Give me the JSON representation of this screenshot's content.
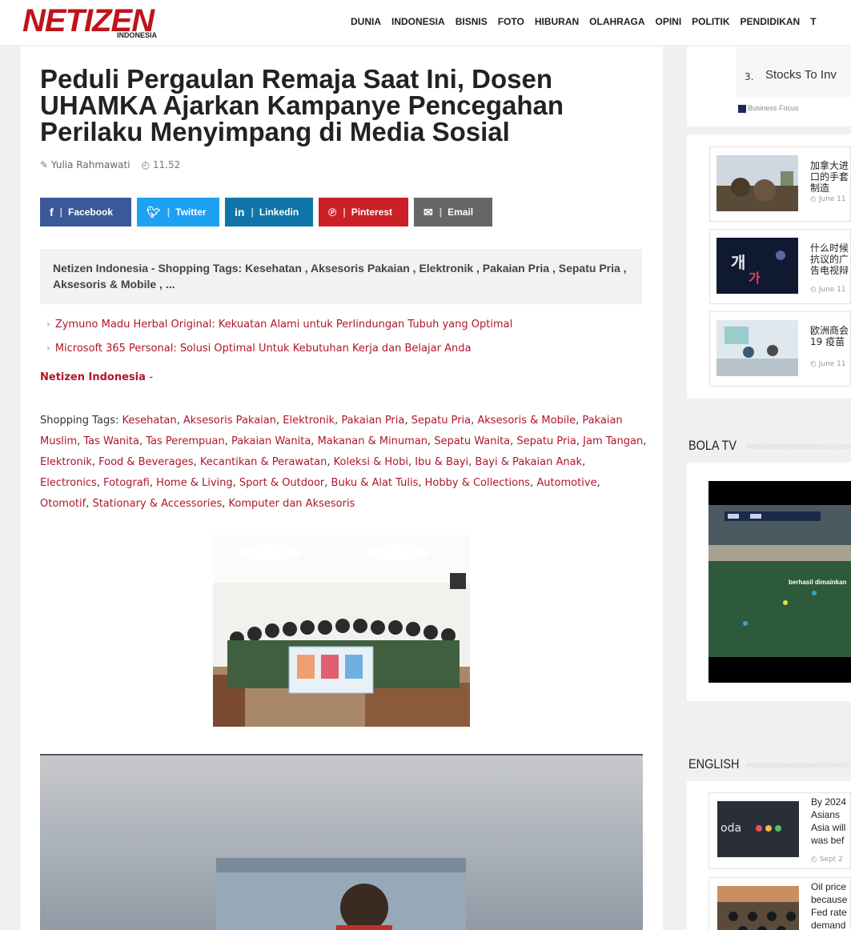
{
  "header": {
    "logo_text": "NETIZEN",
    "logo_sub": "INDONESIA",
    "nav": [
      "DUNIA",
      "INDONESIA",
      "BISNIS",
      "FOTO",
      "HIBURAN",
      "OLAHRAGA",
      "OPINI",
      "POLITIK",
      "PENDIDIKAN",
      "T"
    ]
  },
  "article": {
    "title": "Peduli Pergaulan Remaja Saat Ini, Dosen UHAMKA Ajarkan Kampanye Pencegahan Perilaku Menyimpang di Media Sosial",
    "author": "Yulia Rahmawati",
    "time": "11.52",
    "share": {
      "facebook": "Facebook",
      "twitter": "Twitter",
      "linkedin": "Linkedin",
      "pinterest": "Pinterest",
      "email": "Email"
    },
    "summary": "Netizen Indonesia -  Shopping Tags: Kesehatan , Aksesoris Pakaian , Elektronik , Pakaian Pria , Sepatu Pria , Aksesoris & Mobile , ...",
    "related": [
      "Zymuno Madu Herbal Original: Kekuatan Alami untuk Perlindungan Tubuh yang Optimal",
      "Microsoft 365 Personal: Solusi Optimal Untuk Kebutuhan Kerja dan Belajar Anda"
    ],
    "lead_source": "Netizen Indonesia",
    "lead_dash": "-",
    "tags_prefix": "Shopping Tags: ",
    "tags": [
      "Kesehatan",
      "Aksesoris Pakaian",
      "Elektronik",
      "Pakaian Pria",
      "Sepatu Pria",
      "Aksesoris & Mobile",
      "Pakaian Muslim",
      "Tas Wanita",
      "Tas Perempuan",
      "Pakaian Wanita",
      "Makanan & Minuman",
      "Sepatu Wanita",
      "Sepatu Pria",
      "Jam Tangan",
      "Elektronik",
      "Food & Beverages",
      "Kecantikan & Perawatan",
      "Koleksi & Hobi",
      "Ibu & Bayi",
      "Bayi & Pakaian Anak",
      "Electronics",
      "Fotografi",
      "Home & Living",
      "Sport & Outdoor",
      "Buku & Alat Tulis",
      "Hobby & Collections",
      "Automotive",
      "Otomotif",
      "Stationary & Accessories",
      "Komputer dan Aksesoris"
    ]
  },
  "sidebar": {
    "ad": {
      "number": "3.",
      "text": "Stocks To Inv",
      "source": "Business Focus"
    },
    "news": [
      {
        "title": "加拿大进口的手套制造",
        "date": "June 11"
      },
      {
        "title": "什么时候抗议的广告电视辩论",
        "date": "June 11"
      },
      {
        "title": "欧洲商会19 疫苗",
        "date": "June 11"
      }
    ],
    "bola_title": "BOLA TV",
    "video_caption": "berhasil dimainkan",
    "english_title": "ENGLISH",
    "english": [
      {
        "title": "By 2024 Asians Asia will was bef",
        "date": "Sept 2"
      },
      {
        "title": "Oil price because Fed rate demand",
        "date": ""
      }
    ]
  },
  "colors": {
    "brand": "#c0131b",
    "link": "#b0152a",
    "facebook": "#3b5998",
    "twitter": "#1da1f2",
    "linkedin": "#0e76a8",
    "pinterest": "#cb2027",
    "email": "#666666"
  }
}
